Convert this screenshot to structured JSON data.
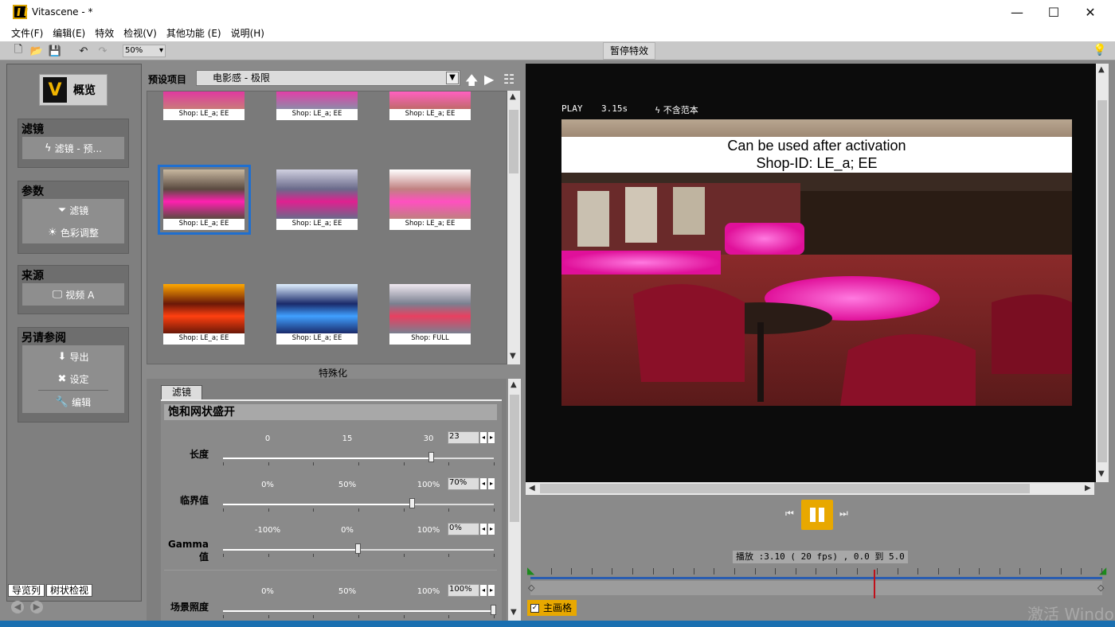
{
  "window": {
    "title": "Vitascene - *",
    "min": "—",
    "max": "☐",
    "close": "✕"
  },
  "menu": [
    "文件(F)",
    "编辑(E)",
    "特效",
    "检视(V)",
    "其他功能 (E)",
    "说明(H)"
  ],
  "toolbar": {
    "zoom": "50%",
    "pause_effects": "暂停特效"
  },
  "sidebar": {
    "logo_label": "概览",
    "groups": [
      {
        "title": "滤镜",
        "items": [
          "滤镜 - 预..."
        ]
      },
      {
        "title": "参数",
        "items": [
          "滤镜",
          "色彩调整"
        ]
      },
      {
        "title": "来源",
        "items": [
          "视频 A"
        ]
      },
      {
        "title": "另请参阅",
        "items": [
          "导出",
          "设定",
          "编辑"
        ]
      }
    ],
    "tabs": [
      "导览列",
      "树状检视"
    ]
  },
  "presets": {
    "label": "预设项目",
    "selected": "电影感 - 极限",
    "thumbs": [
      "Shop: LE_a; EE",
      "Shop: LE_a; EE",
      "Shop: LE_a; EE",
      "Shop: LE_a; EE",
      "Shop: LE_a; EE",
      "Shop: LE_a; EE",
      "Shop: LE_a; EE",
      "Shop: LE_a; EE",
      "Shop: FULL"
    ],
    "category": "特殊化",
    "selected_index": 3
  },
  "filter": {
    "tab": "滤镜",
    "title": "饱和网状盛开",
    "params": [
      {
        "label": "长度",
        "ticks": [
          "0",
          "15",
          "30"
        ],
        "value": "23",
        "pos": 0.77
      },
      {
        "label": "临界值",
        "ticks": [
          "0%",
          "50%",
          "100%"
        ],
        "value": "70%",
        "pos": 0.7
      },
      {
        "label": "Gamma 值",
        "ticks": [
          "-100%",
          "0%",
          "100%"
        ],
        "value": "0%",
        "pos": 0.5
      },
      {
        "label": "场景照度",
        "ticks": [
          "0%",
          "50%",
          "100%"
        ],
        "value": "100%",
        "pos": 1.0
      }
    ]
  },
  "preview": {
    "mode": "PLAY",
    "time": "3.15s",
    "nosample": "不含范本",
    "banner_line1": "Can be used after activation",
    "banner_line2": "Shop-ID:  LE_a; EE"
  },
  "transport": {
    "status": "播放 :3.10 ( 20 fps) , 0.0 到 5.0",
    "main_track": "主画格",
    "playhead": 0.6
  },
  "watermark": "激活 Windo"
}
